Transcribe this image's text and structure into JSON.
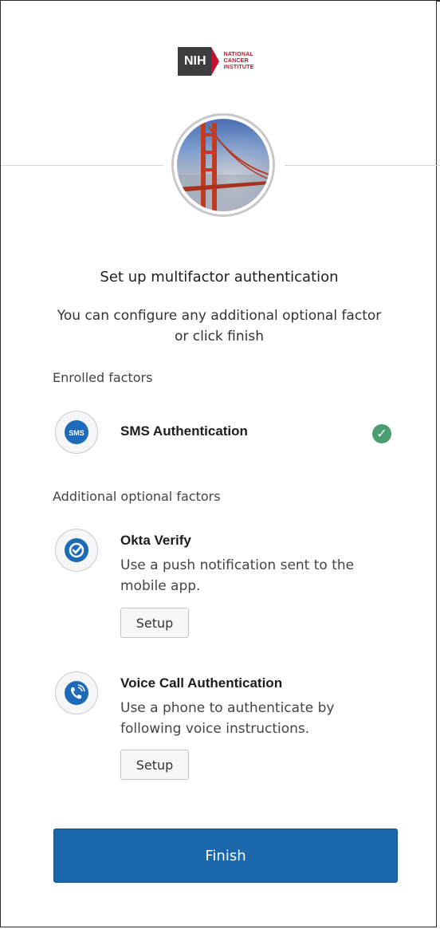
{
  "logo": {
    "short": "NIH",
    "lines": [
      "NATIONAL",
      "CANCER",
      "INSTITUTE"
    ]
  },
  "heading": "Set up multifactor authentication",
  "subtitle": "You can configure any additional optional factor or click finish",
  "enrolled": {
    "label": "Enrolled factors",
    "factors": [
      {
        "title": "SMS Authentication",
        "icon_text": "SMS",
        "icon": "sms-icon",
        "status": "enrolled"
      }
    ]
  },
  "optional": {
    "label": "Additional optional factors",
    "factors": [
      {
        "title": "Okta Verify",
        "description": "Use a push notification sent to the mobile app.",
        "button": "Setup",
        "icon": "okta-verify-icon"
      },
      {
        "title": "Voice Call Authentication",
        "description": "Use a phone to authenticate by following voice instructions.",
        "button": "Setup",
        "icon": "phone-icon"
      }
    ]
  },
  "finish_label": "Finish",
  "colors": {
    "primary": "#1a67ab",
    "success": "#4a9d6e",
    "nih_red": "#c8102e"
  }
}
